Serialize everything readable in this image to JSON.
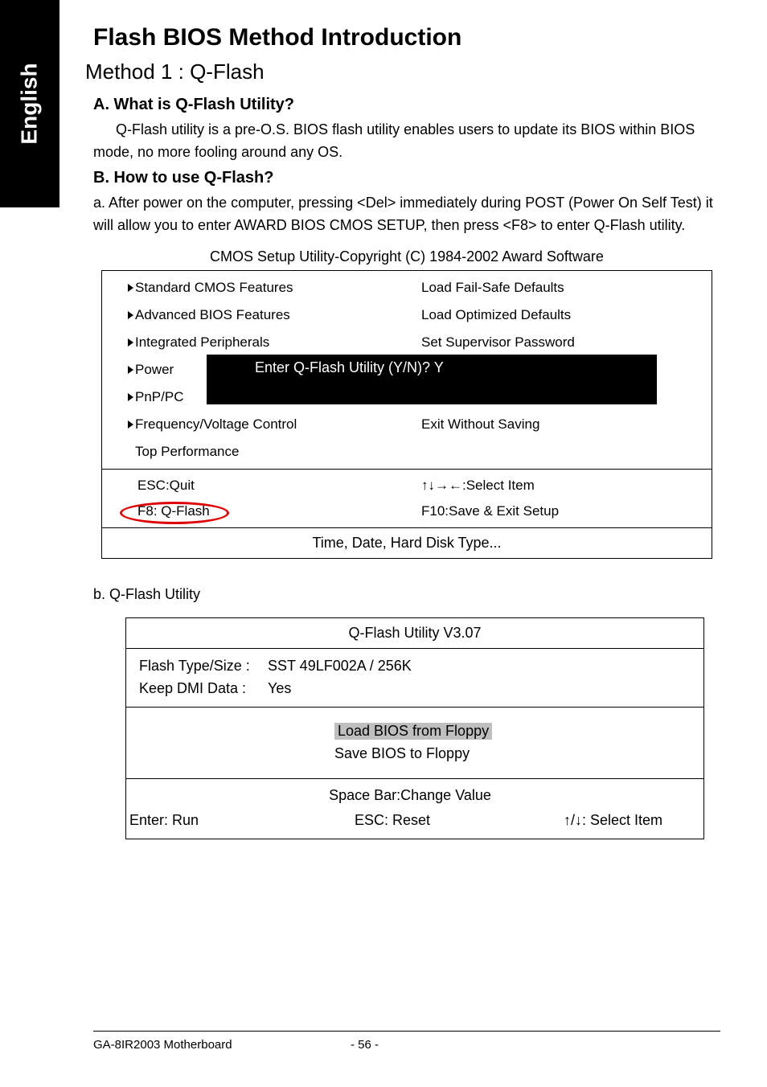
{
  "sidebar": {
    "label": "English"
  },
  "heading": {
    "title": "Flash BIOS Method Introduction",
    "subtitle": "Method 1 : Q-Flash"
  },
  "sectionA": {
    "label": "A.  What is Q-Flash Utility?",
    "body": "Q-Flash utility is a pre-O.S. BIOS flash utility enables users to update its BIOS within BIOS mode, no more fooling around any OS."
  },
  "sectionB": {
    "label": "B.  How to use Q-Flash?",
    "body": "a. After power on the computer, pressing <Del> immediately during POST (Power On Self Test) it will allow you to enter AWARD BIOS CMOS SETUP, then press <F8> to enter Q-Flash utility."
  },
  "cmos": {
    "caption": "CMOS Setup Utility-Copyright (C) 1984-2002 Award Software",
    "left": [
      "Standard CMOS Features",
      "Advanced BIOS Features",
      "Integrated Peripherals",
      "Power",
      "PnP/PC",
      "Frequency/Voltage Control",
      "Top Performance"
    ],
    "right": [
      "Load Fail-Safe Defaults",
      "Load Optimized Defaults",
      "Set Supervisor Password",
      "",
      "",
      "Exit Without Saving",
      ""
    ],
    "overlay": "Enter Q-Flash Utility (Y/N)? Y",
    "mid": {
      "esc": "ESC:Quit",
      "select": "↑↓→←:Select Item",
      "f8": "F8: Q-Flash",
      "f10": "F10:Save & Exit Setup"
    },
    "bottom": "Time, Date, Hard Disk Type..."
  },
  "qflash": {
    "intro": "b. Q-Flash Utility",
    "title": "Q-Flash Utility V3.07",
    "info": [
      {
        "label": "Flash Type/Size   :",
        "value": "SST 49LF002A / 256K"
      },
      {
        "label": "Keep DMI Data    :",
        "value": "Yes"
      }
    ],
    "ops": {
      "load": "Load BIOS from Floppy",
      "save": "Save BIOS to Floppy"
    },
    "foot": {
      "space": "Space Bar:Change Value",
      "enter": "Enter: Run",
      "esc": "ESC: Reset",
      "select": "↑/↓: Select Item"
    }
  },
  "footer": {
    "left": "GA-8IR2003 Motherboard",
    "center": "- 56 -"
  }
}
